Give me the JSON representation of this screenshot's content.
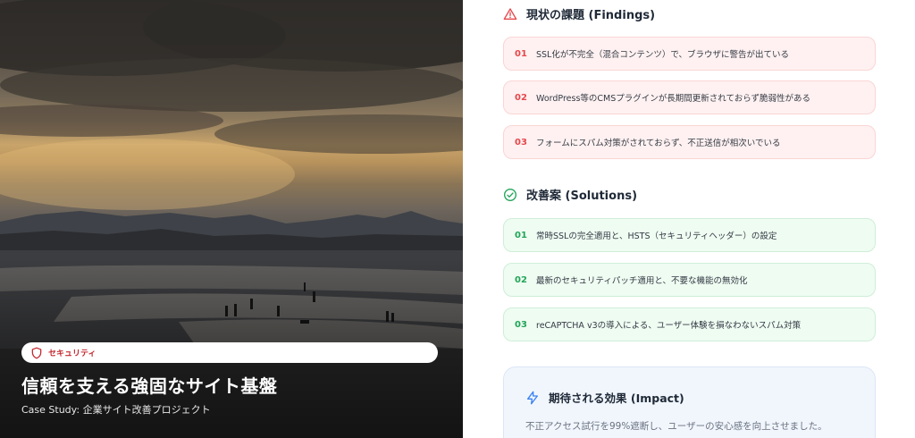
{
  "hero": {
    "tag_label": "セキュリティ",
    "title": "信頼を支える強固なサイト基盤",
    "subtitle": "Case Study: 企業サイト改善プロジェクト"
  },
  "findings": {
    "title": "現状の課題 (Findings)",
    "icon": "warning-triangle-icon",
    "items": [
      {
        "num": "01",
        "text": "SSL化が不完全（混合コンテンツ）で、ブラウザに警告が出ている"
      },
      {
        "num": "02",
        "text": "WordPress等のCMSプラグインが長期間更新されておらず脆弱性がある"
      },
      {
        "num": "03",
        "text": "フォームにスパム対策がされておらず、不正送信が相次いでいる"
      }
    ]
  },
  "solutions": {
    "title": "改善案 (Solutions)",
    "icon": "check-circle-icon",
    "items": [
      {
        "num": "01",
        "text": "常時SSLの完全適用と、HSTS（セキュリティヘッダー）の設定"
      },
      {
        "num": "02",
        "text": "最新のセキュリティパッチ適用と、不要な機能の無効化"
      },
      {
        "num": "03",
        "text": "reCAPTCHA v3の導入による、ユーザー体験を損なわないスパム対策"
      }
    ]
  },
  "impact": {
    "title": "期待される効果 (Impact)",
    "icon": "lightning-bolt-icon",
    "body": "不正アクセス試行を99%遮断し、ユーザーの安心感を向上させました。"
  },
  "colors": {
    "issue_accent": "#e5484d",
    "solution_accent": "#22a559",
    "impact_accent": "#3b82f6",
    "tag_accent": "#c4282f"
  }
}
